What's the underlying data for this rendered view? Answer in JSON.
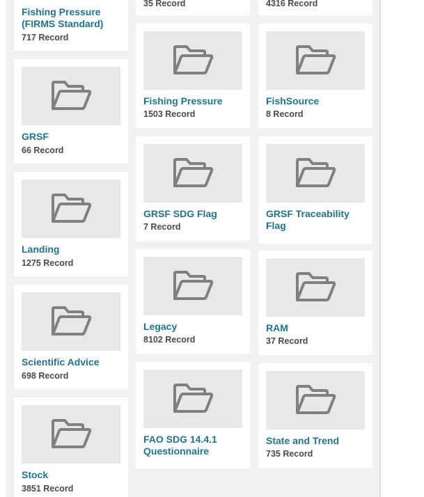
{
  "icon": "folder-open-icon",
  "colors": {
    "title": "#1f7391",
    "count": "#4a4a4a",
    "thumb_bg": "#e8e8e8",
    "icon": "#808080"
  },
  "record_suffix": "Record",
  "columns": [
    {
      "items": [
        {
          "title": "Fishing Pressure (FIRMS Standard)",
          "count": "717 Record"
        },
        {
          "title": "GRSF",
          "count": "66 Record"
        },
        {
          "title": "Landing",
          "count": "1275 Record"
        },
        {
          "title": "Scientific Advice",
          "count": "698 Record"
        },
        {
          "title": "Stock",
          "count": "3851 Record"
        }
      ]
    },
    {
      "items": [
        {
          "title": "",
          "count": "35 Record"
        },
        {
          "title": "Fishing Pressure",
          "count": "1503 Record"
        },
        {
          "title": "GRSF SDG Flag",
          "count": "7 Record"
        },
        {
          "title": "Legacy",
          "count": "8102 Record"
        },
        {
          "title": "FAO SDG 14.4.1 Questionnaire",
          "count": ""
        }
      ]
    },
    {
      "items": [
        {
          "title": "",
          "count": "4316 Record"
        },
        {
          "title": "FishSource",
          "count": "8 Record"
        },
        {
          "title": "GRSF Traceability Flag",
          "count": ""
        },
        {
          "title": "RAM",
          "count": "37 Record"
        },
        {
          "title": "State and Trend",
          "count": "735 Record"
        }
      ]
    }
  ]
}
